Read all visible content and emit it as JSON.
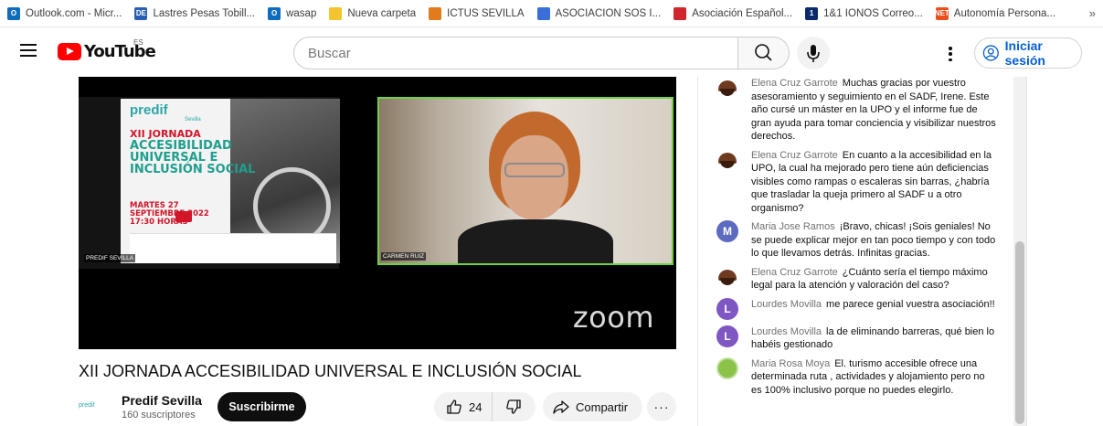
{
  "bookmarks": [
    {
      "label": "Outlook.com - Micr...",
      "icon": "outlook-icon",
      "color": "#0f6cbd",
      "glyph": "O"
    },
    {
      "label": "Lastres Pesas Tobill...",
      "icon": "de-icon",
      "color": "#2b5fb3",
      "glyph": "DE"
    },
    {
      "label": "wasap",
      "icon": "outlook-icon",
      "color": "#0f6cbd",
      "glyph": "O"
    },
    {
      "label": "Nueva carpeta",
      "icon": "folder-icon",
      "color": "#f4c430",
      "glyph": ""
    },
    {
      "label": "ICTUS SEVILLA",
      "icon": "ictus-icon",
      "color": "#e27b1e",
      "glyph": ""
    },
    {
      "label": "ASOCIACION SOS I...",
      "icon": "sos-icon",
      "color": "#3a6fd8",
      "glyph": ""
    },
    {
      "label": "Asociación Español...",
      "icon": "mountain-icon",
      "color": "#d1262d",
      "glyph": ""
    },
    {
      "label": "1&1 IONOS Correo...",
      "icon": "ionos-icon",
      "color": "#0b2a6b",
      "glyph": "1"
    },
    {
      "label": "Autonomía Persona...",
      "icon": "net-icon",
      "color": "#e94e1b",
      "glyph": "NET"
    }
  ],
  "bookmarks_overflow": "»",
  "header": {
    "logo_text": "YouTube",
    "region": "ES",
    "search_placeholder": "Buscar",
    "signin_label": "Iniciar sesión",
    "accent": "#065fd4",
    "brand": "#ff0000"
  },
  "video": {
    "poster_brand": "predif",
    "poster_city": "Sevilla",
    "poster_title_1": "XII JORNADA",
    "poster_title_2": "ACCESIBILIDAD",
    "poster_title_3": "UNIVERSAL E",
    "poster_title_4": "INCLUSIÓN SOCIAL",
    "poster_date_1": "MARTES 27",
    "poster_date_2": "SEPTIEMBRE 2022",
    "poster_date_3": "17:30 HORAS",
    "left_participant": "PREDIF SEVILLA",
    "right_participant": "CARMEN RUIZ",
    "watermark": "zoom"
  },
  "title": "XII JORNADA ACCESIBILIDAD UNIVERSAL E INCLUSIÓN SOCIAL",
  "channel": {
    "name": "Predif Sevilla",
    "subscribers": "160 suscriptores",
    "avatar_text": "predif",
    "subscribe_label": "Suscribirme"
  },
  "actions": {
    "likes": "24",
    "share_label": "Compartir",
    "more_label": "···"
  },
  "chat": [
    {
      "author": "Elena Cruz Garrote",
      "text": "Muchas gracias por vuestro asesoramiento y seguimiento en el SADF, Irene. Este año cursé un máster en la UPO y el informe fue de gran ayuda para tomar conciencia y visibilizar nuestros derechos.",
      "avatar": "cup",
      "initial": ""
    },
    {
      "author": "Elena Cruz Garrote",
      "text": "En cuanto a la accesibilidad en la UPO, la cual ha mejorado pero tiene aún deficiencias visibles como rampas o escaleras sin barras, ¿habría que trasladar la queja primero al SADF u a otro organismo?",
      "avatar": "cup",
      "initial": ""
    },
    {
      "author": "Maria Jose Ramos",
      "text": "¡Bravo, chicas! ¡Sois geniales! No se puede explicar mejor en tan poco tiempo y con todo lo que llevamos detrás. Infinitas gracias.",
      "avatar": "m",
      "initial": "M"
    },
    {
      "author": "Elena Cruz Garrote",
      "text": "¿Cuánto sería el tiempo máximo legal para la atención y valoración del caso?",
      "avatar": "cup",
      "initial": ""
    },
    {
      "author": "Lourdes Movilla",
      "text": "me parece genial vuestra asociación!!",
      "avatar": "l",
      "initial": "L"
    },
    {
      "author": "Lourdes Movilla",
      "text": "la de eliminando barreras, qué bien lo habéis gestionado",
      "avatar": "l",
      "initial": "L"
    },
    {
      "author": "Maria Rosa Moya",
      "text": "El. turismo accesible ofrece una determinada ruta , actividades y alojamiento pero no es 100% inclusivo porque no puedes elegirlo.",
      "avatar": "leaf",
      "initial": ""
    }
  ]
}
